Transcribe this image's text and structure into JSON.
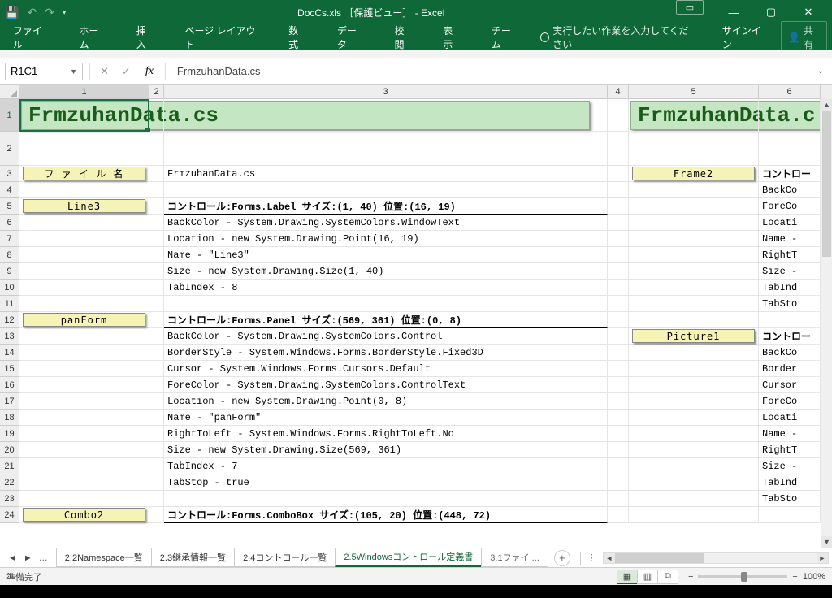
{
  "window": {
    "title": "DocCs.xls ［保護ビュー］ - Excel",
    "signin": "サインイン",
    "share": "共有"
  },
  "ribbon": {
    "tabs": [
      "ファイル",
      "ホーム",
      "挿入",
      "ページ レイアウト",
      "数式",
      "データ",
      "校閲",
      "表示",
      "チーム"
    ],
    "tellme": "実行したい作業を入力してください"
  },
  "formula": {
    "name": "R1C1",
    "value": "FrmzuhanData.cs"
  },
  "cols": [
    "1",
    "2",
    "3",
    "4",
    "5",
    "6"
  ],
  "rows": [
    "1",
    "2",
    "3",
    "4",
    "5",
    "6",
    "7",
    "8",
    "9",
    "10",
    "11",
    "12",
    "13",
    "14",
    "15",
    "16",
    "17",
    "18",
    "19",
    "20",
    "21",
    "22",
    "23",
    "24"
  ],
  "banner1": "FrmzuhanData.cs",
  "banner2": "FrmzuhanData.c",
  "tags": {
    "filename": "フ ァ イ ル 名",
    "line3": "Line3",
    "panform": "panForm",
    "combo2": "Combo2",
    "frame2": "Frame2",
    "picture1": "Picture1"
  },
  "body": {
    "r3c3": "FrmzuhanData.cs",
    "r5c3": "コントロール:Forms.Label サイズ:(1, 40) 位置:(16, 19)",
    "r6c3": "BackColor - System.Drawing.SystemColors.WindowText",
    "r7c3": "Location - new System.Drawing.Point(16, 19)",
    "r8c3": "Name - \"Line3\"",
    "r9c3": "Size - new System.Drawing.Size(1, 40)",
    "r10c3": "TabIndex - 8",
    "r12c3": "コントロール:Forms.Panel サイズ:(569, 361) 位置:(0, 8)",
    "r13c3": "BackColor - System.Drawing.SystemColors.Control",
    "r14c3": "BorderStyle - System.Windows.Forms.BorderStyle.Fixed3D",
    "r15c3": "Cursor - System.Windows.Forms.Cursors.Default",
    "r16c3": "ForeColor - System.Drawing.SystemColors.ControlText",
    "r17c3": "Location - new System.Drawing.Point(0, 8)",
    "r18c3": "Name - \"panForm\"",
    "r19c3": "RightToLeft - System.Windows.Forms.RightToLeft.No",
    "r20c3": "Size - new System.Drawing.Size(569, 361)",
    "r21c3": "TabIndex - 7",
    "r22c3": "TabStop - true",
    "r24c3": "コントロール:Forms.ComboBox サイズ:(105, 20) 位置:(448, 72)"
  },
  "side": {
    "r3c6": "コントロー",
    "r4c6": "BackCo",
    "r5c6": "ForeCo",
    "r6c6": "Locati",
    "r7c6": "Name -",
    "r8c6": "RightT",
    "r9c6": "Size -",
    "r10c6": "TabInd",
    "r11c6": "TabSto",
    "r13c6": "コントロー",
    "r14c6": "BackCo",
    "r15c6": "Border",
    "r16c6": "Cursor",
    "r17c6": "ForeCo",
    "r18c6": "Locati",
    "r19c6": "Name -",
    "r20c6": "RightT",
    "r21c6": "Size -",
    "r22c6": "TabInd",
    "r23c6": "TabSto"
  },
  "sheettabs": [
    "2.2Namespace一覧",
    "2.3継承情報一覧",
    "2.4コントロール一覧",
    "2.5Windowsコントロール定義書",
    "3.1ファイ ..."
  ],
  "active_sheet": 3,
  "status": {
    "ready": "準備完了",
    "zoom": "100%"
  }
}
